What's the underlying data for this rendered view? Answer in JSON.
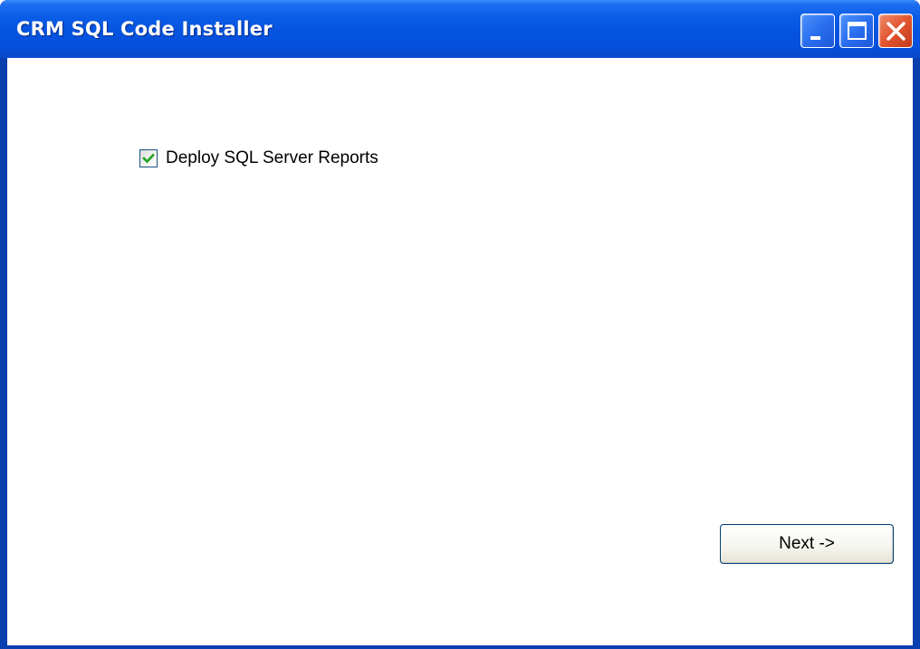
{
  "window": {
    "title": "CRM SQL Code Installer"
  },
  "titlebar_buttons": {
    "minimize": "minimize-icon",
    "maximize": "maximize-icon",
    "close": "close-icon"
  },
  "content": {
    "checkbox": {
      "label": "Deploy SQL Server Reports",
      "checked": true,
      "check_color": "#21a121"
    },
    "next_button_label": "Next ->"
  }
}
